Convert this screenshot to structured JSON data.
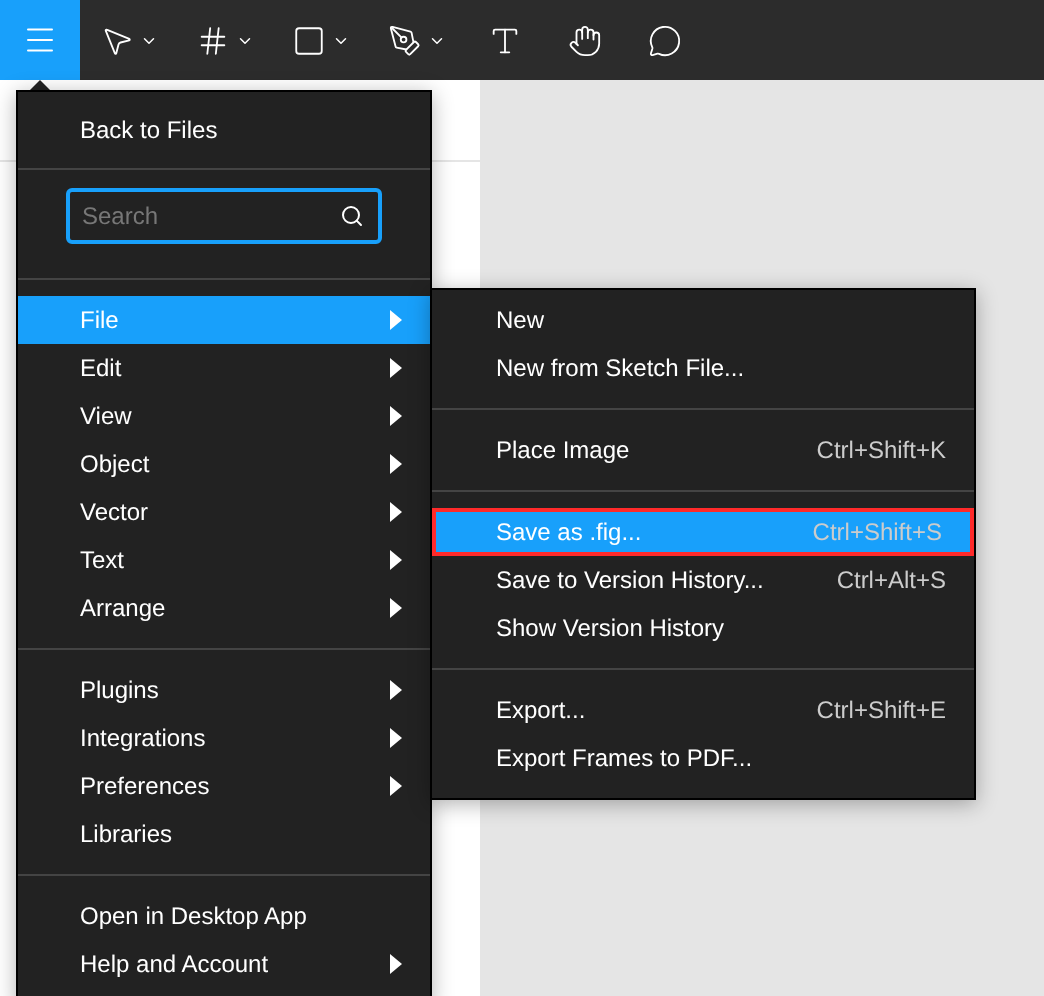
{
  "toolbar": {
    "tools": [
      {
        "kind": "menu",
        "selected": true,
        "has_dropdown": false
      },
      {
        "kind": "move",
        "selected": false,
        "has_dropdown": true
      },
      {
        "kind": "frame",
        "selected": false,
        "has_dropdown": true
      },
      {
        "kind": "shape",
        "selected": false,
        "has_dropdown": true
      },
      {
        "kind": "pen",
        "selected": false,
        "has_dropdown": true
      },
      {
        "kind": "text",
        "selected": false,
        "has_dropdown": false
      },
      {
        "kind": "hand",
        "selected": false,
        "has_dropdown": false
      },
      {
        "kind": "comment",
        "selected": false,
        "has_dropdown": false
      }
    ]
  },
  "main_menu": {
    "header": "Back to Files",
    "search": {
      "placeholder": "Search"
    },
    "groups": [
      [
        {
          "label": "File",
          "has_submenu": true,
          "selected": true
        },
        {
          "label": "Edit",
          "has_submenu": true,
          "selected": false
        },
        {
          "label": "View",
          "has_submenu": true,
          "selected": false
        },
        {
          "label": "Object",
          "has_submenu": true,
          "selected": false
        },
        {
          "label": "Vector",
          "has_submenu": true,
          "selected": false
        },
        {
          "label": "Text",
          "has_submenu": true,
          "selected": false
        },
        {
          "label": "Arrange",
          "has_submenu": true,
          "selected": false
        }
      ],
      [
        {
          "label": "Plugins",
          "has_submenu": true,
          "selected": false
        },
        {
          "label": "Integrations",
          "has_submenu": true,
          "selected": false
        },
        {
          "label": "Preferences",
          "has_submenu": true,
          "selected": false
        },
        {
          "label": "Libraries",
          "has_submenu": false,
          "selected": false
        }
      ],
      [
        {
          "label": "Open in Desktop App",
          "has_submenu": false,
          "selected": false
        },
        {
          "label": "Help and Account",
          "has_submenu": true,
          "selected": false
        }
      ]
    ]
  },
  "submenu": {
    "groups": [
      [
        {
          "label": "New",
          "selected": false,
          "outlined": false
        },
        {
          "label": "New from Sketch File...",
          "selected": false,
          "outlined": false
        }
      ],
      [
        {
          "label": "Place Image",
          "shortcut": "Ctrl+Shift+K",
          "selected": false,
          "outlined": false
        }
      ],
      [
        {
          "label": "Save as .fig...",
          "shortcut": "Ctrl+Shift+S",
          "selected": true,
          "outlined": true
        },
        {
          "label": "Save to Version History...",
          "shortcut": "Ctrl+Alt+S",
          "selected": false,
          "outlined": false
        },
        {
          "label": "Show Version History",
          "selected": false,
          "outlined": false
        }
      ],
      [
        {
          "label": "Export...",
          "shortcut": "Ctrl+Shift+E",
          "selected": false,
          "outlined": false
        },
        {
          "label": "Export Frames to PDF...",
          "selected": false,
          "outlined": false
        }
      ]
    ]
  }
}
